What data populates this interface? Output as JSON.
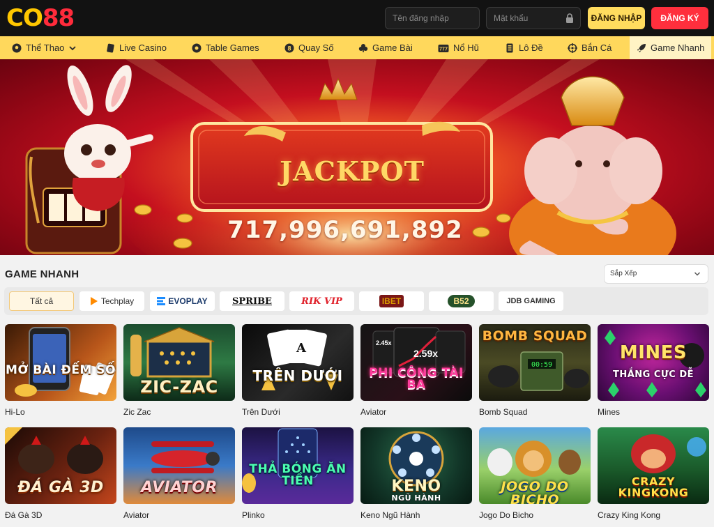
{
  "header": {
    "logo_co": "CO",
    "logo_num": "88",
    "username_placeholder": "Tên đăng nhập",
    "password_placeholder": "Mật khẩu",
    "login_label": "ĐĂNG NHẬP",
    "register_label": "ĐĂNG KÝ"
  },
  "nav": {
    "items": [
      {
        "label": "Thể Thao",
        "icon": "soccer-ball-icon"
      },
      {
        "label": "Live Casino",
        "icon": "playing-card-icon"
      },
      {
        "label": "Table Games",
        "icon": "poker-chip-icon"
      },
      {
        "label": "Quay Số",
        "icon": "lottery-ball-icon"
      },
      {
        "label": "Game Bài",
        "icon": "club-suit-icon"
      },
      {
        "label": "Nổ Hũ",
        "icon": "slot-machine-icon"
      },
      {
        "label": "Lô Đề",
        "icon": "lottery-ticket-icon"
      },
      {
        "label": "Bắn Cá",
        "icon": "crosshair-icon"
      },
      {
        "label": "Game Nhanh",
        "icon": "rocket-icon"
      }
    ],
    "active": "Game Nhanh"
  },
  "banner": {
    "title": "JACKPOT",
    "amount": "717,996,691,892"
  },
  "section": {
    "title": "GAME NHANH",
    "sort_label": "Sắp Xếp"
  },
  "providers": {
    "all_label": "Tất cả",
    "items": [
      "Techplay",
      "EVOPLAY",
      "SPRIBE",
      "RIK VIP",
      "IBET",
      "B52",
      "JDB GAMING"
    ]
  },
  "games": [
    {
      "name": "Hi-Lo",
      "caption": "MỞ BÀI ĐẾM SỐ"
    },
    {
      "name": "Zic Zac",
      "caption": "ZIC-ZAC"
    },
    {
      "name": "Trên Dưới",
      "caption": "TRÊN DƯỚI"
    },
    {
      "name": "Aviator",
      "caption": "PHI CÔNG TÀI BA",
      "tag": "2.59x"
    },
    {
      "name": "Bomb Squad",
      "caption": "BOMB SQUAD"
    },
    {
      "name": "Mines",
      "caption": "MINES",
      "subcaption": "THẮNG CỰC DỄ"
    },
    {
      "name": "Đá Gà 3D",
      "caption": "ĐÁ GÀ 3D"
    },
    {
      "name": "Aviator",
      "caption": "AVIATOR"
    },
    {
      "name": "Plinko",
      "caption": "THẢ BÓNG ĂN TIỀN"
    },
    {
      "name": "Keno Ngũ Hành",
      "caption": "KENO",
      "subcaption": "NGŨ HÀNH"
    },
    {
      "name": "Jogo Do Bicho",
      "caption": "JOGO DO BICHO"
    },
    {
      "name": "Crazy King Kong",
      "caption": "CRAZY KINGKONG"
    }
  ],
  "colors": {
    "topbar": "#121212",
    "nav": "#ffd85c",
    "accent_yellow": "#ffdc5e",
    "accent_red": "#ff2f3d"
  }
}
